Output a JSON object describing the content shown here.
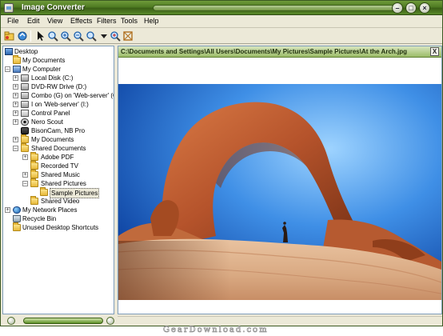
{
  "window": {
    "title": "Image Converter"
  },
  "menu": {
    "items": [
      {
        "label": "File"
      },
      {
        "label": "Edit"
      },
      {
        "label": "View"
      },
      {
        "label": "Effects"
      },
      {
        "label": "Filters"
      },
      {
        "label": "Tools"
      },
      {
        "label": "Help"
      }
    ]
  },
  "toolbar": {
    "buttons": [
      "open-folder-icon",
      "save-icon",
      "pointer-icon",
      "zoom-icon",
      "zoom-in-icon",
      "zoom-out-icon",
      "zoom-fit-icon",
      "zoom-actual-icon",
      "crop-icon",
      "fullscreen-icon"
    ]
  },
  "tree": {
    "items": [
      {
        "label": "Desktop",
        "icon": "desktop-icon"
      },
      {
        "label": "My Documents",
        "icon": "folder-icon"
      },
      {
        "label": "My Computer",
        "icon": "computer-icon"
      },
      {
        "label": "Local Disk (C:)",
        "icon": "drive-icon"
      },
      {
        "label": "DVD-RW Drive (D:)",
        "icon": "drive-icon"
      },
      {
        "label": "Combo (G) on 'Web-server' (G:)",
        "icon": "drive-icon"
      },
      {
        "label": "I on 'Web-server' (I:)",
        "icon": "drive-icon"
      },
      {
        "label": "Control Panel",
        "icon": "control-panel-icon"
      },
      {
        "label": "Nero Scout",
        "icon": "nero-icon"
      },
      {
        "label": "BisonCam, NB Pro",
        "icon": "camera-icon"
      },
      {
        "label": "My Documents",
        "icon": "folder-icon"
      },
      {
        "label": "Shared Documents",
        "icon": "folder-icon"
      },
      {
        "label": "Adobe PDF",
        "icon": "folder-icon"
      },
      {
        "label": "Recorded TV",
        "icon": "folder-icon"
      },
      {
        "label": "Shared Music",
        "icon": "folder-icon"
      },
      {
        "label": "Shared Pictures",
        "icon": "folder-icon"
      },
      {
        "label": "Sample Pictures",
        "icon": "folder-icon",
        "selected": true
      },
      {
        "label": "Shared Video",
        "icon": "folder-icon"
      },
      {
        "label": "My Network Places",
        "icon": "network-icon"
      },
      {
        "label": "Recycle Bin",
        "icon": "recycle-bin-icon"
      },
      {
        "label": "Unused Desktop Shortcuts",
        "icon": "folder-icon"
      }
    ]
  },
  "viewer": {
    "path": "C:\\Documents and Settings\\All Users\\Documents\\My Pictures\\Sample Pictures\\At the Arch.jpg",
    "close_label": "X"
  },
  "watermark": {
    "text": "GearDownload.com"
  },
  "colors": {
    "titlebar": "#4f7b22",
    "path_bar": "#9bbb67",
    "sky": "#1f6fd8",
    "rock": "#b8532c"
  }
}
